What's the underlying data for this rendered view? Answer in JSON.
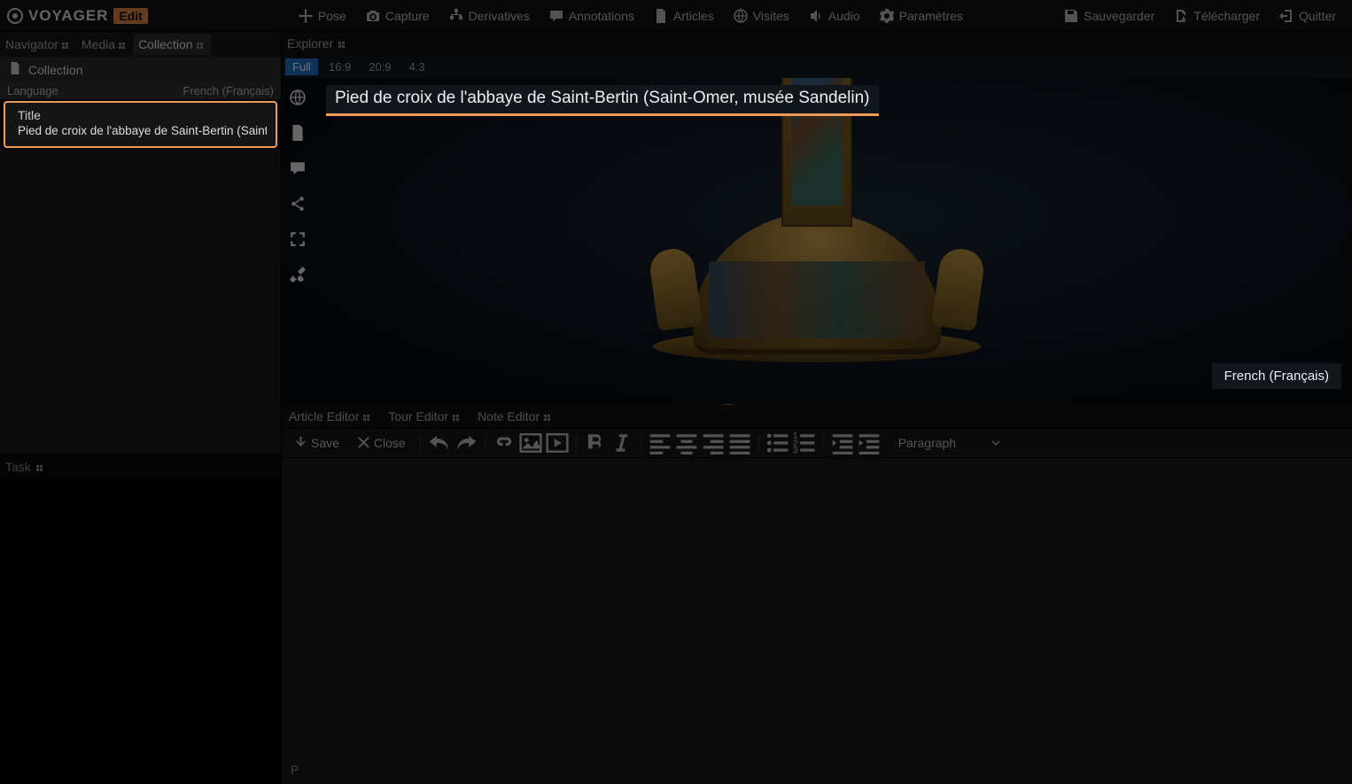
{
  "brand": {
    "name": "VOYAGER",
    "mode": "Edit"
  },
  "toolbar": {
    "pose": "Pose",
    "capture": "Capture",
    "derivatives": "Derivatives",
    "annotations": "Annotations",
    "articles": "Articles",
    "visites": "Visites",
    "audio": "Audio",
    "parametres": "Paramètres",
    "sauvegarder": "Sauvegarder",
    "telecharger": "Télécharger",
    "quitter": "Quitter"
  },
  "leftTabs": {
    "navigator": "Navigator",
    "media": "Media",
    "collection": "Collection"
  },
  "collectionPanel": {
    "header": "Collection",
    "languageLabel": "Language",
    "languageValue": "French (Français)",
    "titleLabel": "Title",
    "titleValue": "Pied de croix de l'abbaye de Saint-Bertin (Saint-Omer, musée Sandelin)",
    "titleValueTruncated": "Pied de croix de l'abbaye de Saint-Bertin (Saint-On"
  },
  "task": {
    "label": "Task"
  },
  "explorer": {
    "label": "Explorer"
  },
  "aspect": {
    "full": "Full",
    "r169": "16:9",
    "r209": "20:9",
    "r43": "4:3"
  },
  "sceneTitle": "Pied de croix de l'abbaye de Saint-Bertin (Saint-Omer, musée Sandelin)",
  "viewerLangBadge": "French (Français)",
  "bottomTabs": {
    "article": "Article Editor",
    "tour": "Tour Editor",
    "note": "Note Editor"
  },
  "editorToolbar": {
    "save": "Save",
    "close": "Close",
    "paragraph": "Paragraph"
  },
  "editorStatus": "P"
}
